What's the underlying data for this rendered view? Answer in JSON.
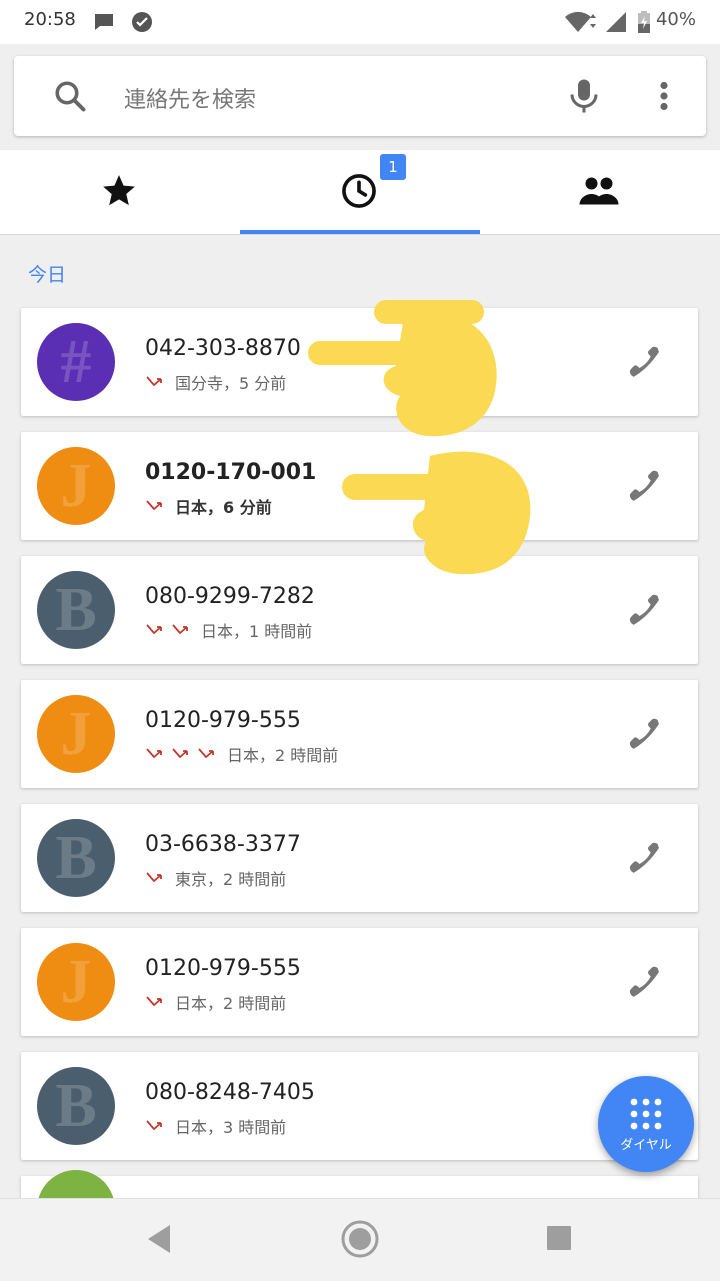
{
  "status_bar": {
    "time": "20:58",
    "battery": "40%"
  },
  "search": {
    "placeholder": "連絡先を検索"
  },
  "tabs": [
    {
      "name": "favorites",
      "icon": "star-icon"
    },
    {
      "name": "recents",
      "icon": "clock-icon",
      "badge": "1",
      "selected": true
    },
    {
      "name": "contacts",
      "icon": "people-icon"
    }
  ],
  "section_header": "今日",
  "calls": [
    {
      "number": "042-303-8870",
      "location_time": "国分寺，5 分前",
      "missed_count": 1,
      "avatar_color": "#5b2fb4",
      "glyph": "#",
      "bold": false
    },
    {
      "number": "0120-170-001",
      "location_time": "日本，6 分前",
      "missed_count": 1,
      "avatar_color": "#ef8c12",
      "glyph": "J",
      "bold": true
    },
    {
      "number": "080-9299-7282",
      "location_time": "日本，1 時間前",
      "missed_count": 2,
      "avatar_color": "#4b5e6d",
      "glyph": "B",
      "bold": false
    },
    {
      "number": "0120-979-555",
      "location_time": "日本，2 時間前",
      "missed_count": 3,
      "avatar_color": "#ef8c12",
      "glyph": "J",
      "bold": false
    },
    {
      "number": "03-6638-3377",
      "location_time": "東京，2 時間前",
      "missed_count": 1,
      "avatar_color": "#4b5e6d",
      "glyph": "B",
      "bold": false
    },
    {
      "number": "0120-979-555",
      "location_time": "日本，2 時間前",
      "missed_count": 1,
      "avatar_color": "#ef8c12",
      "glyph": "J",
      "bold": false
    },
    {
      "number": "080-8248-7405",
      "location_time": "日本，3 時間前",
      "missed_count": 1,
      "avatar_color": "#4b5e6d",
      "glyph": "B",
      "bold": false
    }
  ],
  "fab": {
    "label": "ダイヤル"
  },
  "colors": {
    "accent": "#4285f4",
    "missed": "#c0392b",
    "overlay_hand": "#fbd953"
  }
}
